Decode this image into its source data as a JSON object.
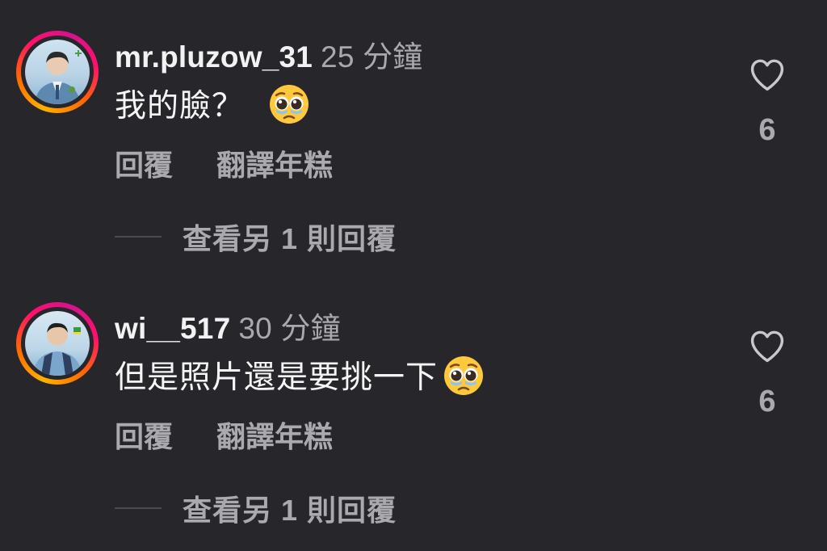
{
  "comments": [
    {
      "username": "mr.pluzow_31",
      "time": "25 分鐘",
      "text": "我的臉？",
      "emoji": "pleading-face",
      "actions": {
        "reply": "回覆",
        "translate": "翻譯年糕"
      },
      "view_more": "查看另 1 則回覆",
      "likes": "6"
    },
    {
      "username": "wi__517",
      "time": "30 分鐘",
      "text": "但是照片還是要挑一下",
      "emoji": "pleading-face",
      "actions": {
        "reply": "回覆",
        "translate": "翻譯年糕"
      },
      "view_more": "查看另 1 則回覆",
      "likes": "6"
    }
  ],
  "colors": {
    "background": "#26262b",
    "primary_text": "#f5f5f5",
    "secondary_text": "#a9a9ae",
    "story_ring": [
      "#ffb100",
      "#ff0f6b",
      "#d4138f"
    ]
  }
}
